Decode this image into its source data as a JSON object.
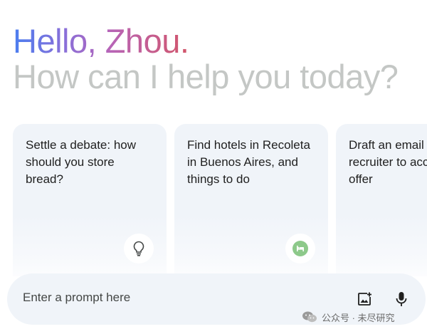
{
  "greeting": {
    "hello": "Hello, Zhou.",
    "subtitle": "How can I help you today?"
  },
  "cards": [
    {
      "text": "Settle a debate: how should you store bread?",
      "icon": "lightbulb-icon"
    },
    {
      "text": "Find hotels in Recoleta in Buenos Aires, and things to do",
      "icon": "hotel-icon"
    },
    {
      "text": "Draft an email to a recruiter to accept a job offer",
      "icon": ""
    }
  ],
  "prompt": {
    "placeholder": "Enter a prompt here",
    "image_icon": "add-image-icon",
    "mic_icon": "microphone-icon"
  },
  "watermark": {
    "text": "公众号 · 未尽研究"
  },
  "colors": {
    "gradient": [
      "#4b7ef0",
      "#8a6fd8",
      "#b765b8",
      "#d2566a"
    ],
    "subtitle": "#c4c7c5",
    "card_bg": "#f0f4f9",
    "hotel_badge": "#8dc98a"
  }
}
